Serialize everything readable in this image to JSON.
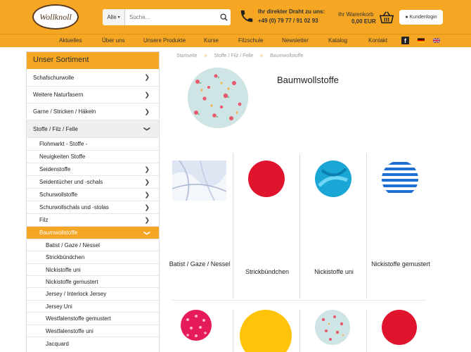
{
  "header": {
    "logo_text": "Wollknoll",
    "search": {
      "category": "Alle",
      "placeholder": "Suche..."
    },
    "phone": {
      "line1": "Ihr direkter Draht zu uns:",
      "line2": "+49 (0) 79 77 / 91 02 93"
    },
    "cart": {
      "label": "Ihr Warenkorb",
      "amount": "0,00 EUR"
    },
    "login_label": "Kundenlogin"
  },
  "nav": {
    "items": [
      "Aktuelles",
      "Über uns",
      "Unsere Produkte",
      "Kurse",
      "Filzschule",
      "Newsletter",
      "Katalog",
      "Kontakt"
    ]
  },
  "sidebar": {
    "title": "Unser Sortiment",
    "items": [
      {
        "label": "Schafschurwolle"
      },
      {
        "label": "Weitere Naturfasern"
      },
      {
        "label": "Garne / Stricken / Häkeln"
      },
      {
        "label": "Stoffe / Filz / Felle"
      },
      {
        "label": "Flohmarkt - Stoffe -"
      },
      {
        "label": "Neuigkeiten Stoffe"
      },
      {
        "label": "Seidenstoffe"
      },
      {
        "label": "Seidentücher und -schals"
      },
      {
        "label": "Schurwollstoffe"
      },
      {
        "label": "Schurwollschals und -stolas"
      },
      {
        "label": "Filz"
      },
      {
        "label": "Baumwollstoffe"
      },
      {
        "label": "Batist / Gaze / Nessel"
      },
      {
        "label": "Strickbündchen"
      },
      {
        "label": "Nickistoffe uni"
      },
      {
        "label": "Nickistoffe gemustert"
      },
      {
        "label": "Jersey / Interlock Jersey"
      },
      {
        "label": "Jersey Uni"
      },
      {
        "label": "Westfalenstoffe gemustert"
      },
      {
        "label": "Westfalenstoffe uni"
      },
      {
        "label": "Jacquard"
      }
    ]
  },
  "breadcrumb": {
    "items": [
      "Startseite",
      "Stoffe / Filz / Felle",
      "Baumwollstoffe"
    ],
    "separator": "»"
  },
  "page": {
    "title": "Baumwollstoffe"
  },
  "products": [
    {
      "label": "Batist / Gaze / Nessel"
    },
    {
      "label": "Strickbündchen"
    },
    {
      "label": "Nickistoffe uni"
    },
    {
      "label": "Nickistoffe gemustert"
    }
  ],
  "colors": {
    "accent": "#f5a623",
    "red": "#e0142d",
    "turquoise": "#1aa7d6",
    "yellow": "#ffc40a",
    "pink": "#e51b5a"
  }
}
